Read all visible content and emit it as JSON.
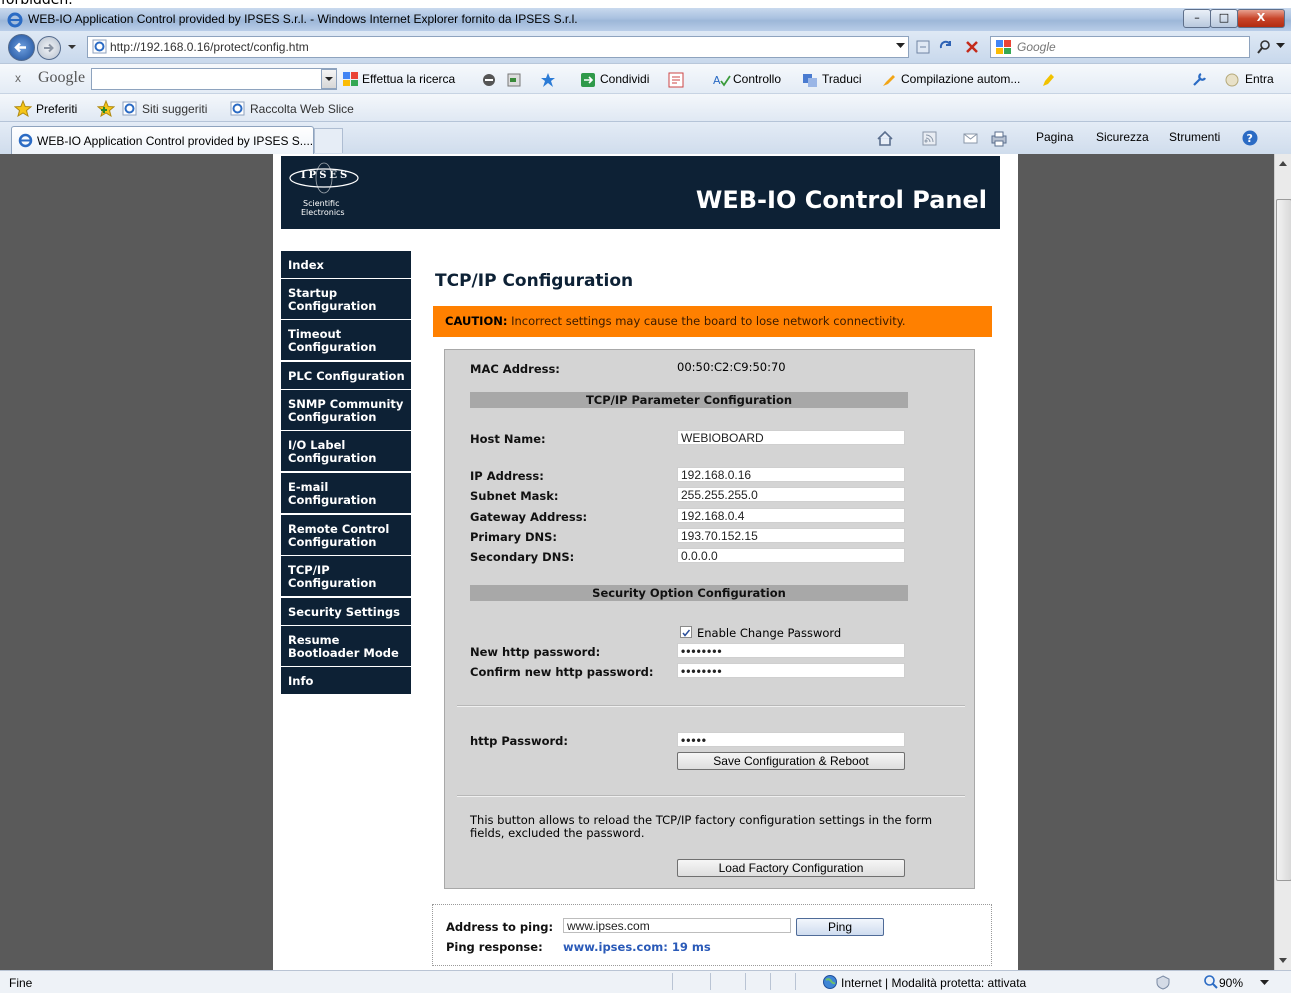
{
  "clipped_top_text": "forbidden.",
  "window": {
    "title": "WEB-IO Application Control provided by IPSES S.r.l. - Windows Internet Explorer fornito da IPSES S.r.l.",
    "min": "–",
    "max": "□",
    "close": "X"
  },
  "address": {
    "url": "http://192.168.0.16/protect/config.htm",
    "search_placeholder": "Google"
  },
  "google_toolbar": {
    "close": "x",
    "logo": "Google",
    "search_btn": "Effettua la ricerca",
    "share": "Condividi",
    "check": "Controllo",
    "translate": "Traduci",
    "autofill": "Compilazione autom...",
    "signin": "Entra"
  },
  "favorites": {
    "label": "Preferiti",
    "suggested": "Siti suggeriti",
    "webslice": "Raccolta Web Slice"
  },
  "tabs": {
    "active_tab": "WEB-IO Application Control provided by IPSES S....",
    "page_menu": "Pagina",
    "safety_menu": "Sicurezza",
    "tools_menu": "Strumenti"
  },
  "page": {
    "logo_text": "IPSES",
    "logo_sub1": "Scientific",
    "logo_sub2": "Electronics",
    "banner_title": "WEB-IO Control Panel",
    "nav": [
      {
        "l1": "Index",
        "l2": ""
      },
      {
        "l1": "Startup",
        "l2": "Configuration"
      },
      {
        "l1": "Timeout",
        "l2": "Configuration"
      },
      {
        "l1": "PLC Configuration",
        "l2": ""
      },
      {
        "l1": "SNMP Community",
        "l2": "Configuration"
      },
      {
        "l1": "I/O Label",
        "l2": "Configuration"
      },
      {
        "l1": "E-mail",
        "l2": "Configuration"
      },
      {
        "l1": "Remote Control",
        "l2": "Configuration"
      },
      {
        "l1": "TCP/IP",
        "l2": "Configuration"
      },
      {
        "l1": "Security Settings",
        "l2": ""
      },
      {
        "l1": "Resume",
        "l2": "Bootloader Mode"
      },
      {
        "l1": "Info",
        "l2": ""
      }
    ],
    "title": "TCP/IP Configuration",
    "caution_label": "CAUTION:",
    "caution_text": " Incorrect settings may cause the board to lose network connectivity.",
    "mac_label": "MAC Address:",
    "mac_value": "00:50:C2:C9:50:70",
    "section_tcpip": "TCP/IP Parameter Configuration",
    "host_label": "Host Name:",
    "host_value": "WEBIOBOARD",
    "ip_label": "IP Address:",
    "ip_value": "192.168.0.16",
    "subnet_label": "Subnet Mask:",
    "subnet_value": "255.255.255.0",
    "gateway_label": "Gateway Address:",
    "gateway_value": "192.168.0.4",
    "dns1_label": "Primary DNS:",
    "dns1_value": "193.70.152.15",
    "dns2_label": "Secondary DNS:",
    "dns2_value": "0.0.0.0",
    "section_security": "Security Option Configuration",
    "enable_change_pw": "Enable Change Password",
    "new_pw_label": "New http password:",
    "new_pw_value": "••••••••",
    "confirm_pw_label": "Confirm new http password:",
    "confirm_pw_value": "••••••••",
    "http_pw_label": "http Password:",
    "http_pw_value": "•••••",
    "save_btn": "Save Configuration & Reboot",
    "factory_note": "This button allows to reload the TCP/IP factory configuration settings in the form fields, excluded the password.",
    "factory_btn": "Load Factory Configuration",
    "ping_label": "Address to ping:",
    "ping_value": "www.ipses.com",
    "ping_btn": "Ping",
    "ping_resp_label": "Ping response:",
    "ping_resp_value": "www.ipses.com: 19 ms"
  },
  "status": {
    "left": "Fine",
    "zone": "Internet | Modalità protetta: attivata",
    "zoom": "90%"
  }
}
